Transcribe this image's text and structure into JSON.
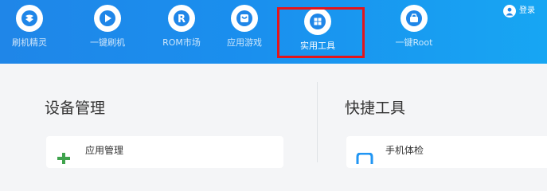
{
  "nav": {
    "items": [
      {
        "label": "刷机精灵",
        "icon": "flash-sprite-icon"
      },
      {
        "label": "一键刷机",
        "icon": "one-click-flash-icon"
      },
      {
        "label": "ROM市场",
        "icon": "rom-market-icon"
      },
      {
        "label": "应用游戏",
        "icon": "apps-games-icon"
      },
      {
        "label": "实用工具",
        "icon": "tools-grid-icon",
        "active": true
      },
      {
        "label": "一键Root",
        "icon": "one-click-root-icon"
      }
    ],
    "login_label": "登录"
  },
  "sections": {
    "device": {
      "title": "设备管理",
      "first_item": "应用管理"
    },
    "quick": {
      "title": "快捷工具",
      "first_item": "手机体检"
    }
  },
  "colors": {
    "bar_start": "#1f86e8",
    "bar_end": "#17a6f3",
    "active_highlight": "#e4151b",
    "app_mgmt_icon": "#3fa34d",
    "phone_check_icon": "#2196f3"
  }
}
